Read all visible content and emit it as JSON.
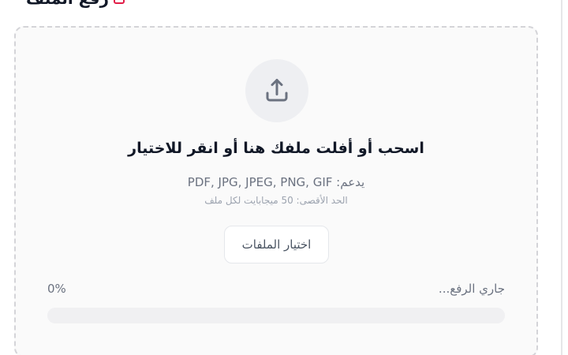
{
  "header": {
    "title": "رفع الملف"
  },
  "upload": {
    "icon": "upload-icon",
    "prompt": "اسحب أو أفلت ملفك هنا أو انقر للاختيار",
    "supported": "يدعم: PDF, JPG, JPEG, PNG, GIF",
    "max_size": "الحد الأقصى: 50 ميجابايت لكل ملف",
    "select_button_label": "اختيار الملفات"
  },
  "progress": {
    "label": "جاري الرفع...",
    "percent_text": "0%",
    "value": 0
  },
  "colors": {
    "accent": "#3b82f6",
    "heading_icon": "#e11d48"
  }
}
